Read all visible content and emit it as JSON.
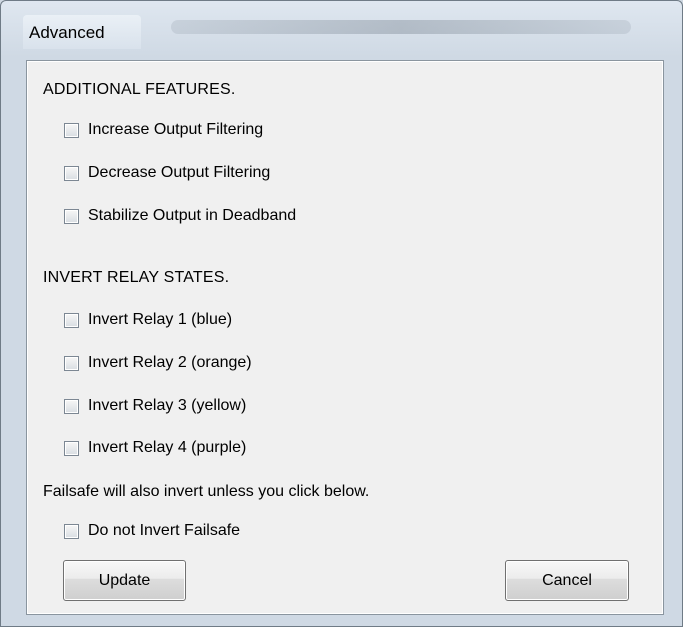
{
  "window": {
    "title": "Advanced"
  },
  "sections": {
    "additional_features": {
      "heading": "ADDITIONAL FEATURES.",
      "items": [
        {
          "label": "Increase Output Filtering",
          "checked": false
        },
        {
          "label": "Decrease Output Filtering",
          "checked": false
        },
        {
          "label": "Stabilize Output in Deadband",
          "checked": false
        }
      ]
    },
    "invert_relay_states": {
      "heading": "INVERT RELAY STATES.",
      "items": [
        {
          "label": "Invert Relay 1 (blue)",
          "checked": false
        },
        {
          "label": "Invert Relay 2 (orange)",
          "checked": false
        },
        {
          "label": "Invert Relay 3 (yellow)",
          "checked": false
        },
        {
          "label": "Invert Relay 4 (purple)",
          "checked": false
        }
      ]
    },
    "failsafe": {
      "note": "Failsafe will also invert unless you click below.",
      "item": {
        "label": "Do not Invert Failsafe",
        "checked": false
      }
    }
  },
  "buttons": {
    "update": "Update",
    "cancel": "Cancel"
  },
  "colors": {
    "dialog_background": "#f0f0f0",
    "window_frame": "#cfd9e4",
    "button_border": "#707070",
    "checkbox_border": "#7c8793"
  }
}
